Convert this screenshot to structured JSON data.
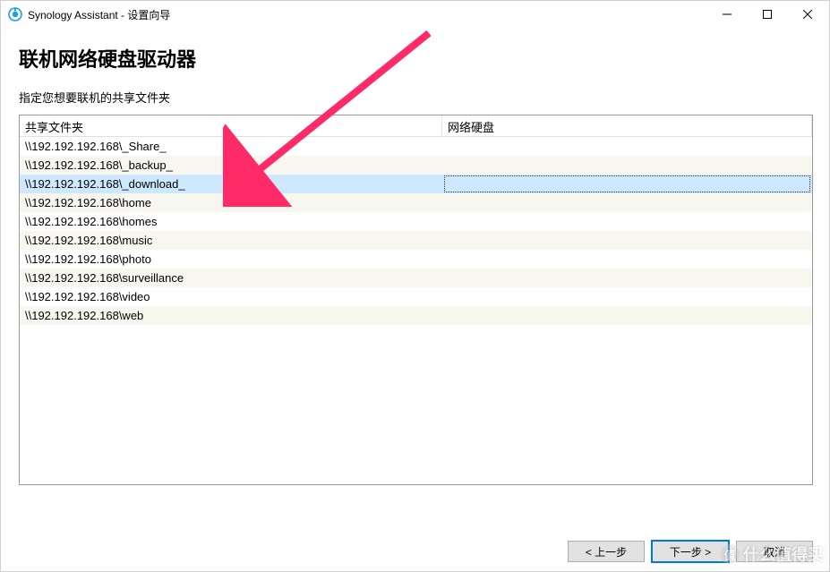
{
  "window": {
    "title": "Synology Assistant  - 设置向导"
  },
  "heading": "联机网络硬盘驱动器",
  "subheading": "指定您想要联机的共享文件夹",
  "columns": {
    "share": "共享文件夹",
    "drive": "网络硬盘"
  },
  "rows": [
    {
      "path": "\\\\192.192.192.168\\_Share_",
      "drive": "",
      "selected": false
    },
    {
      "path": "\\\\192.192.192.168\\_backup_",
      "drive": "",
      "selected": false
    },
    {
      "path": "\\\\192.192.192.168\\_download_",
      "drive": "",
      "selected": true
    },
    {
      "path": "\\\\192.192.192.168\\home",
      "drive": "",
      "selected": false
    },
    {
      "path": "\\\\192.192.192.168\\homes",
      "drive": "",
      "selected": false
    },
    {
      "path": "\\\\192.192.192.168\\music",
      "drive": "",
      "selected": false
    },
    {
      "path": "\\\\192.192.192.168\\photo",
      "drive": "",
      "selected": false
    },
    {
      "path": "\\\\192.192.192.168\\surveillance",
      "drive": "",
      "selected": false
    },
    {
      "path": "\\\\192.192.192.168\\video",
      "drive": "",
      "selected": false
    },
    {
      "path": "\\\\192.192.192.168\\web",
      "drive": "",
      "selected": false
    }
  ],
  "buttons": {
    "back": "< 上一步",
    "next": "下一步 >",
    "cancel": "取消"
  },
  "watermark": "什么值得买"
}
